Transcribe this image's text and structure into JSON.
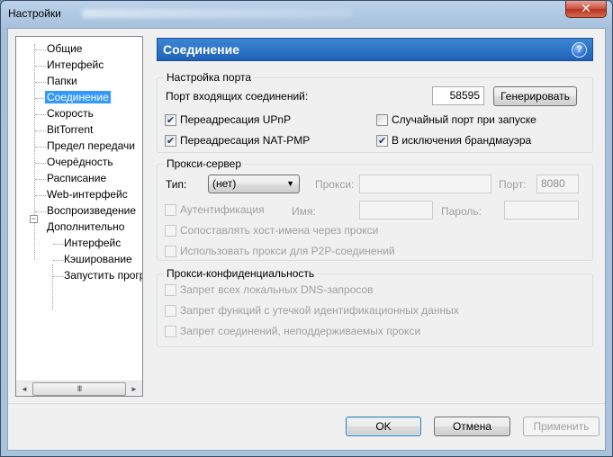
{
  "window": {
    "title": "Настройки",
    "close_glyph": "✕"
  },
  "tree": {
    "items": [
      {
        "label": "Общие"
      },
      {
        "label": "Интерфейс"
      },
      {
        "label": "Папки"
      },
      {
        "label": "Соединение",
        "selected": true
      },
      {
        "label": "Скорость"
      },
      {
        "label": "BitTorrent"
      },
      {
        "label": "Предел передачи"
      },
      {
        "label": "Очерёдность"
      },
      {
        "label": "Расписание"
      },
      {
        "label": "Web-интерфейс"
      },
      {
        "label": "Воспроизведение"
      },
      {
        "label": "Дополнительно",
        "expanded": true
      },
      {
        "label": "Интерфейс",
        "child": true
      },
      {
        "label": "Кэширование",
        "child": true
      },
      {
        "label": "Запустить прогр",
        "child": true
      }
    ],
    "expander_glyph": "−",
    "scroll_left": "◄",
    "scroll_right": "►",
    "scroll_thumb": "III"
  },
  "panel": {
    "title": "Соединение",
    "help_glyph": "?",
    "port_group": {
      "title": "Настройка порта",
      "incoming_port_label": "Порт входящих соединений:",
      "incoming_port_value": "58595",
      "generate_button": "Генерировать",
      "upnp": {
        "label": "Переадресация UPnP",
        "checked": true
      },
      "natpmp": {
        "label": "Переадресация NAT-PMP",
        "checked": true
      },
      "random_port": {
        "label": "Случайный порт при запуске",
        "checked": false
      },
      "firewall": {
        "label": "В исключения брандмауэра",
        "checked": true
      }
    },
    "proxy_group": {
      "title": "Прокси-сервер",
      "type_label": "Тип:",
      "type_value": "(нет)",
      "proxy_label": "Прокси:",
      "proxy_value": "",
      "port_label": "Порт:",
      "port_value": "8080",
      "auth_label": "Аутентификация",
      "username_label": "Имя:",
      "username_value": "",
      "password_label": "Пароль:",
      "password_value": "",
      "resolve_label": "Сопоставлять хост-имена через прокси",
      "p2p_label": "Использовать прокси для P2P-соединений"
    },
    "privacy_group": {
      "title": "Прокси-конфиденциальность",
      "dns_label": "Запрет всех локальных DNS-запросов",
      "leak_label": "Запрет функций с утечкой идентификационных данных",
      "unsupported_label": "Запрет соединений, неподдерживаемых прокси"
    }
  },
  "footer": {
    "ok": "OK",
    "cancel": "Отмена",
    "apply": "Применить"
  }
}
